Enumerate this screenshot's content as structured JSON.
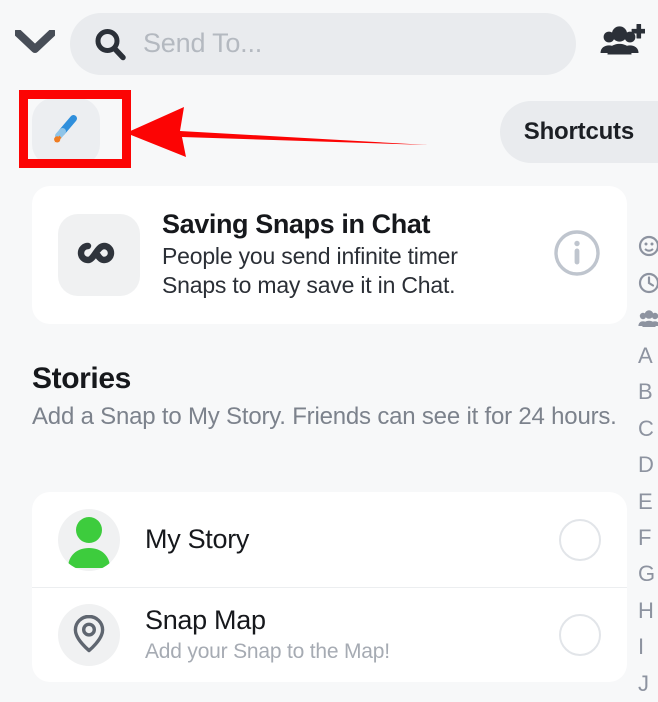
{
  "app": {
    "name": "Snapchat Send To screen",
    "background_color": "#f7f8f9",
    "accent_green": "#3dcc3d",
    "annotation_color": "#fc0404"
  },
  "topbar": {
    "chevron_icon": "chevron-down-icon",
    "search": {
      "icon": "search-icon",
      "placeholder": "Send To...",
      "value": ""
    },
    "add_friends_icon": "add-friends-icon"
  },
  "action_row": {
    "brush_button": {
      "icon": "paintbrush-icon",
      "label": ""
    },
    "shortcuts_button": {
      "label": "Shortcuts"
    }
  },
  "info_card": {
    "icon": "infinity-icon",
    "title": "Saving Snaps in Chat",
    "subtitle_line1": "People you send infinite timer",
    "subtitle_line2": "Snaps to may save it in Chat.",
    "info_icon": "info-circle-icon"
  },
  "stories": {
    "title": "Stories",
    "description": "Add a Snap to My Story. Friends can see it for 24 hours.",
    "rows": [
      {
        "icon": "person-silhouette-icon",
        "label": "My Story",
        "sub": "",
        "selected": false
      },
      {
        "icon": "map-pin-icon",
        "label": "Snap Map",
        "sub": "Add your Snap to the Map!",
        "selected": false
      }
    ]
  },
  "right_strip": {
    "items": [
      {
        "kind": "icon",
        "name": "emoji-face-icon",
        "label": ""
      },
      {
        "kind": "icon",
        "name": "clock-recent-icon",
        "label": ""
      },
      {
        "kind": "icon",
        "name": "group-friends-icon",
        "label": ""
      },
      {
        "kind": "letter",
        "name": "index-letter-a",
        "label": "A"
      },
      {
        "kind": "letter",
        "name": "index-letter-b",
        "label": "B"
      },
      {
        "kind": "letter",
        "name": "index-letter-c",
        "label": "C"
      },
      {
        "kind": "letter",
        "name": "index-letter-d",
        "label": "D"
      },
      {
        "kind": "letter",
        "name": "index-letter-e",
        "label": "E"
      },
      {
        "kind": "letter",
        "name": "index-letter-f",
        "label": "F"
      },
      {
        "kind": "letter",
        "name": "index-letter-g",
        "label": "G"
      },
      {
        "kind": "letter",
        "name": "index-letter-h",
        "label": "H"
      },
      {
        "kind": "letter",
        "name": "index-letter-i",
        "label": "I"
      },
      {
        "kind": "letter",
        "name": "index-letter-j",
        "label": "J"
      }
    ]
  },
  "annotations": {
    "highlight_rect_target": "paintbrush-button",
    "arrow_points_to": "paintbrush-button"
  }
}
